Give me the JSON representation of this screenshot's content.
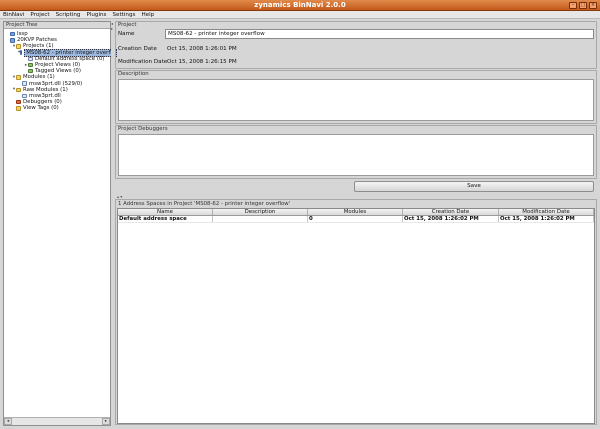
{
  "window": {
    "title": "zynamics BinNavi 2.0.0",
    "controls": [
      "–",
      "□",
      "×"
    ]
  },
  "menu": [
    "BinNavi",
    "Project",
    "Scripting",
    "Plugins",
    "Settings",
    "Help"
  ],
  "tree": {
    "header": "Project Tree",
    "items": [
      {
        "label": "Issp",
        "icon": "database-icon",
        "depth": 0,
        "toggle": ""
      },
      {
        "label": "20KVP Patches",
        "icon": "database-icon",
        "depth": 0,
        "toggle": ""
      },
      {
        "label": "Projects (1)",
        "icon": "folder-icon",
        "depth": 1,
        "toggle": "▾"
      },
      {
        "label": "MS08-62 - printer integer overflo",
        "icon": "project-icon",
        "depth": 2,
        "toggle": "▾",
        "selected": true
      },
      {
        "label": "Default address space (0)",
        "icon": "address-space-icon",
        "depth": 3,
        "toggle": ""
      },
      {
        "label": "Project Views (0)",
        "icon": "views-icon",
        "depth": 3,
        "toggle": "▸"
      },
      {
        "label": "Tagged Views (0)",
        "icon": "tagged-views-icon",
        "depth": 3,
        "toggle": ""
      },
      {
        "label": "Modules (1)",
        "icon": "folder-icon",
        "depth": 1,
        "toggle": "▾"
      },
      {
        "label": "msw3prt.dll (529/0)",
        "icon": "module-icon",
        "depth": 2,
        "toggle": ""
      },
      {
        "label": "Raw Modules (1)",
        "icon": "folder-icon",
        "depth": 1,
        "toggle": "▾"
      },
      {
        "label": "msw3prt.dll",
        "icon": "raw-module-icon",
        "depth": 2,
        "toggle": ""
      },
      {
        "label": "Debuggers (0)",
        "icon": "debugger-icon",
        "depth": 1,
        "toggle": ""
      },
      {
        "label": "View Tags (0)",
        "icon": "tag-icon",
        "depth": 1,
        "toggle": ""
      }
    ]
  },
  "project": {
    "section": "Project",
    "name_label": "Name",
    "name_value": "MS08-62 - printer integer overflow",
    "creation_label": "Creation Date",
    "creation_value": "Oct 15, 2008 1:26:01 PM",
    "modification_label": "Modification Date",
    "modification_value": "Oct 15, 2008 1:26:15 PM",
    "description_section": "Description",
    "debuggers_section": "Project Debuggers",
    "save_label": "Save"
  },
  "address_spaces": {
    "caption": "1 Address Spaces in Project 'MS08-62 - printer integer overflow'",
    "columns": [
      "Name",
      "Description",
      "Modules",
      "Creation Date",
      "Modification Date"
    ],
    "rows": [
      [
        "Default address space",
        "",
        "0",
        "Oct 15, 2008 1:26:02 PM",
        "Oct 15, 2008 1:26:02 PM"
      ]
    ]
  }
}
